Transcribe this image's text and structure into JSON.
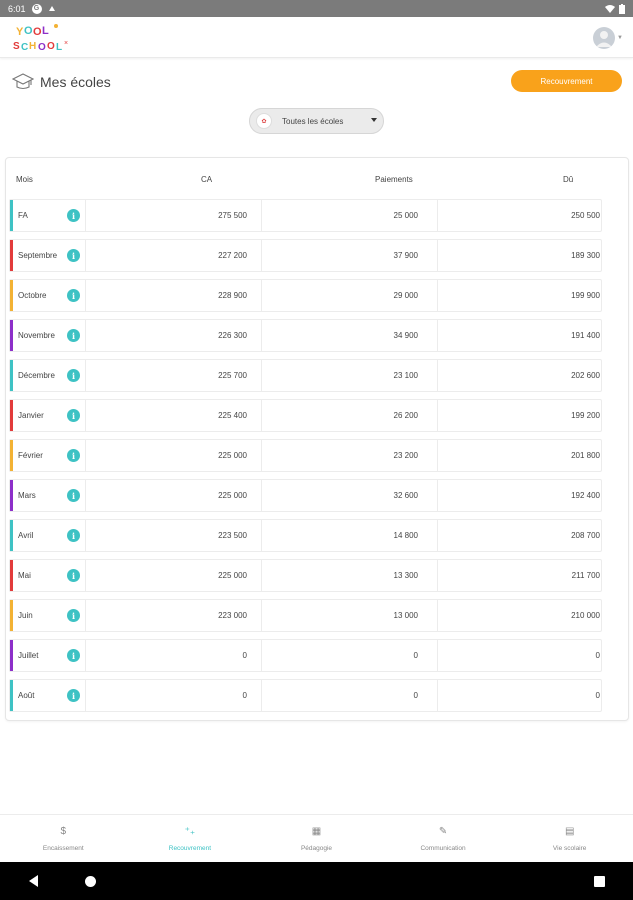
{
  "status_bar": {
    "time": "6:01",
    "g_badge": "G"
  },
  "header": {
    "logo_text_top": "YOOL",
    "logo_text_bottom": "SCHOOL"
  },
  "page": {
    "title": "Mes écoles",
    "recouvrement_button": "Recouvrement",
    "school_select": {
      "value": "Toutes les écoles"
    }
  },
  "table": {
    "headers": {
      "mois": "Mois",
      "ca": "CA",
      "paiements": "Paiements",
      "du": "Dû"
    },
    "info_glyph": "i",
    "rows": [
      {
        "month": "FA",
        "ca": "275 500",
        "paiements": "25 000",
        "du": "250 500",
        "color": "#3ec2c4"
      },
      {
        "month": "Septembre",
        "ca": "227 200",
        "paiements": "37 900",
        "du": "189 300",
        "color": "#e23b3b"
      },
      {
        "month": "Octobre",
        "ca": "228 900",
        "paiements": "29 000",
        "du": "199 900",
        "color": "#f3b234"
      },
      {
        "month": "Novembre",
        "ca": "226 300",
        "paiements": "34 900",
        "du": "191 400",
        "color": "#8d2fc9"
      },
      {
        "month": "Décembre",
        "ca": "225 700",
        "paiements": "23 100",
        "du": "202 600",
        "color": "#3ec2c4"
      },
      {
        "month": "Janvier",
        "ca": "225 400",
        "paiements": "26 200",
        "du": "199 200",
        "color": "#e23b3b"
      },
      {
        "month": "Février",
        "ca": "225 000",
        "paiements": "23 200",
        "du": "201 800",
        "color": "#f3b234"
      },
      {
        "month": "Mars",
        "ca": "225 000",
        "paiements": "32 600",
        "du": "192 400",
        "color": "#8d2fc9"
      },
      {
        "month": "Avril",
        "ca": "223 500",
        "paiements": "14 800",
        "du": "208 700",
        "color": "#3ec2c4"
      },
      {
        "month": "Mai",
        "ca": "225 000",
        "paiements": "13 300",
        "du": "211 700",
        "color": "#e23b3b"
      },
      {
        "month": "Juin",
        "ca": "223 000",
        "paiements": "13 000",
        "du": "210 000",
        "color": "#f3b234"
      },
      {
        "month": "Juillet",
        "ca": "0",
        "paiements": "0",
        "du": "0",
        "color": "#8d2fc9"
      },
      {
        "month": "Août",
        "ca": "0",
        "paiements": "0",
        "du": "0",
        "color": "#3ec2c4"
      }
    ]
  },
  "bottom_nav": [
    {
      "label": "Encaissement",
      "icon": "dollar-icon",
      "glyph": "$",
      "active": false
    },
    {
      "label": "Recouvrement",
      "icon": "recouvrement-icon",
      "glyph": "⁺₊",
      "active": true
    },
    {
      "label": "Pédagogie",
      "icon": "grid-icon",
      "glyph": "▦",
      "active": false
    },
    {
      "label": "Communication",
      "icon": "edit-doc-icon",
      "glyph": "✎",
      "active": false
    },
    {
      "label": "Vie scolaire",
      "icon": "document-icon",
      "glyph": "▤",
      "active": false
    }
  ],
  "colors": {
    "accent_teal": "#3ec2c4",
    "button_orange": "#f9a21b",
    "status_bar": "#7b7b7b"
  }
}
